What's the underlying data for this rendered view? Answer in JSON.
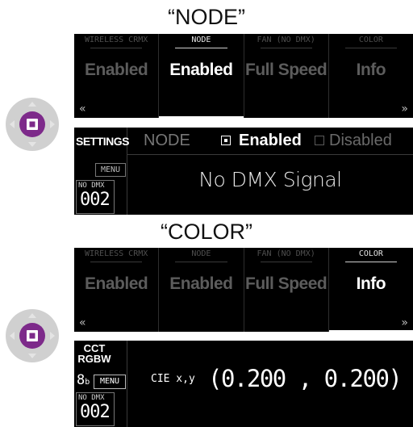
{
  "captions": {
    "node": "“NODE”",
    "color": "“COLOR”"
  },
  "node_menu": {
    "tabs": [
      {
        "label": "WIRELESS CRMX",
        "value": "Enabled"
      },
      {
        "label": "NODE",
        "value": "Enabled"
      },
      {
        "label": "FAN (NO DMX)",
        "value": "Full Speed"
      },
      {
        "label": "COLOR",
        "value": "Info"
      }
    ],
    "prev_arrow": "«",
    "next_arrow": "»"
  },
  "node_status": {
    "mode": "SETTINGS",
    "menu_btn": "MENU",
    "dmx_label": "NO DMX",
    "dmx_value": "002",
    "title": "NODE",
    "opt_on": "Enabled",
    "opt_off": "Disabled",
    "message": "No DMX Signal"
  },
  "color_menu": {
    "tabs": [
      {
        "label": "WIRELESS CRMX",
        "value": "Enabled"
      },
      {
        "label": "NODE",
        "value": "Enabled"
      },
      {
        "label": "FAN (NO DMX)",
        "value": "Full Speed"
      },
      {
        "label": "COLOR",
        "value": "Info"
      }
    ],
    "prev_arrow": "«",
    "next_arrow": "»"
  },
  "color_status": {
    "mode_line1": "CCT",
    "mode_line2": "RGBW",
    "bits": "8",
    "bits_sub": "b",
    "menu_btn": "MENU",
    "dmx_label": "NO DMX",
    "dmx_value": "002",
    "cie_label": "CIE x,y",
    "cie_value": "(0.200 , 0.200)"
  },
  "colors": {
    "dial_outer": "#d2d2d2",
    "dial_center": "#7d2a8a",
    "accent_white": "#ffffff"
  }
}
